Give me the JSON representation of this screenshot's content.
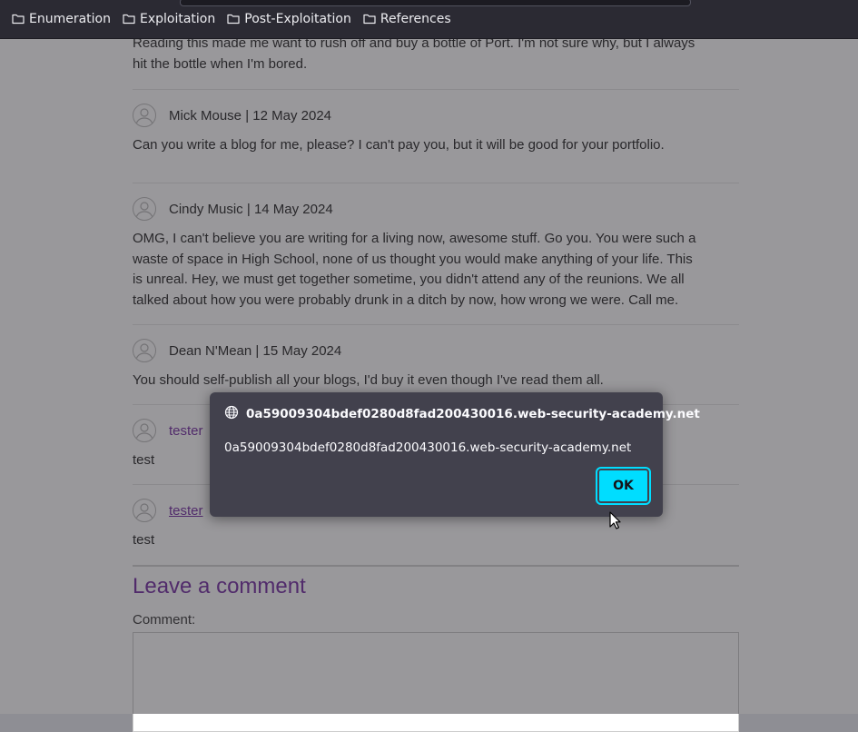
{
  "bookmarks": [
    {
      "label": "Enumeration",
      "icon": "folder-icon"
    },
    {
      "label": "Exploitation",
      "icon": "folder-icon"
    },
    {
      "label": "Post-Exploitation",
      "icon": "folder-icon"
    },
    {
      "label": "References",
      "icon": "folder-icon"
    }
  ],
  "comments": [
    {
      "author": "",
      "date": "",
      "text_lines": [
        "Reading this made me want to rush off and buy a bottle of Port. I'm not sure why, but I always",
        "hit the bottle when I'm bored."
      ]
    },
    {
      "author": "Mick Mouse",
      "sep": "|",
      "date": "12 May 2024",
      "text_lines": [
        "Can you write a blog for me, please? I can't pay you, but it will be good for your portfolio."
      ]
    },
    {
      "author": "Cindy Music",
      "sep": "|",
      "date": "14 May 2024",
      "text_lines": [
        "OMG, I can't believe you are writing for a living now, awesome stuff. Go you. You were such a",
        "waste of space in High School, none of us thought you would make anything of your life. This",
        "is unreal. Hey, we must get together sometime, you didn't attend any of the reunions. We all",
        "talked about how you were probably drunk in a ditch by now, how wrong we were. Call me."
      ]
    },
    {
      "author": "Dean N'Mean",
      "sep": "|",
      "date": "15 May 2024",
      "text_lines": [
        "You should self-publish all your blogs, I'd buy it even though I've read them all."
      ]
    },
    {
      "author": "tester",
      "date": "",
      "text_lines": [
        "test"
      ]
    },
    {
      "author": "tester",
      "date": "",
      "text_lines": [
        "test"
      ]
    }
  ],
  "leave_comment": {
    "heading": "Leave a comment",
    "label": "Comment:",
    "value": ""
  },
  "dialog": {
    "title": "0a59009304bdef0280d8fad200430016.web-security-academy.net",
    "message": "0a59009304bdef0280d8fad200430016.web-security-academy.net",
    "ok_label": "OK"
  },
  "colors": {
    "toolbar_bg": "#2b2a33",
    "dialog_bg": "#42414d",
    "ok_button": "#00ddff",
    "link": "#7c3aa8"
  }
}
